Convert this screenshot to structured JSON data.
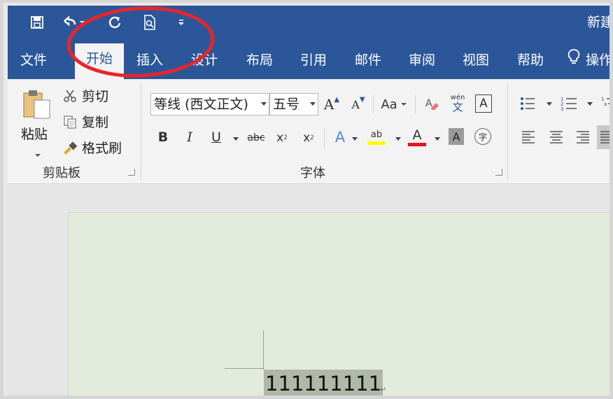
{
  "title_bar": {
    "doc_title": "新建"
  },
  "quick_access": {
    "icons": [
      "save-icon",
      "undo-icon",
      "redo-icon",
      "print-preview-icon",
      "customize-qat-icon"
    ]
  },
  "tabs": {
    "file": "文件",
    "home": "开始",
    "insert": "插入",
    "design": "设计",
    "layout": "布局",
    "references": "引用",
    "mailings": "邮件",
    "review": "审阅",
    "view": "视图",
    "help": "帮助",
    "tell_me": "操作"
  },
  "clipboard": {
    "paste": "粘贴",
    "cut": "剪切",
    "copy": "复制",
    "format_painter": "格式刷",
    "group_label": "剪贴板"
  },
  "font": {
    "font_name": "等线 (西文正文)",
    "font_size": "五号",
    "grow": "A",
    "shrink": "A",
    "change_case": "Aa",
    "phonetic_top": "wén",
    "phonetic_bottom": "文",
    "border_char": "A",
    "bold": "B",
    "italic": "I",
    "underline": "U",
    "strike": "abc",
    "subscript": "x",
    "subscript_sub": "2",
    "superscript": "x",
    "superscript_sup": "2",
    "text_effects": "A",
    "highlight": "ab",
    "font_color": "A",
    "char_shading": "A",
    "enclose": "字",
    "group_label": "字体",
    "highlight_color": "#ffff00",
    "font_color_value": "#e81123"
  },
  "document": {
    "selected_text": "111111111",
    "paragraph_mark": "↵"
  },
  "colors": {
    "ribbon_blue": "#2b579a",
    "annotation_red": "#e8252b",
    "page_bg": "#e3ecdc"
  }
}
